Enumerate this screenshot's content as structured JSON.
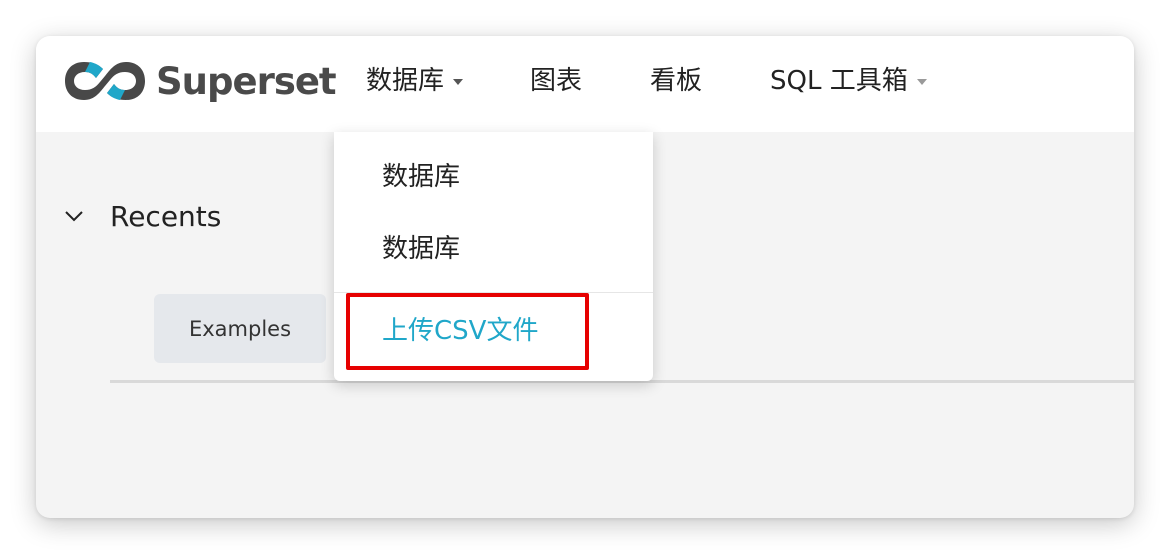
{
  "brand": {
    "name": "Superset",
    "logo_colors": {
      "dark": "#484848",
      "accent": "#20a7c9"
    }
  },
  "navbar": {
    "items": [
      {
        "label": "数据库",
        "has_caret": true
      },
      {
        "label": "图表",
        "has_caret": false
      },
      {
        "label": "看板",
        "has_caret": false
      },
      {
        "label": "SQL 工具箱",
        "has_caret": true
      }
    ]
  },
  "dropdown": {
    "items": [
      {
        "label": "数据库"
      },
      {
        "label": "数据库"
      },
      {
        "label": "上传CSV文件",
        "highlighted": true
      }
    ],
    "highlight_color": "#20a7c9",
    "annotation_color": "#e60000"
  },
  "recents": {
    "title": "Recents",
    "tabs": [
      {
        "label": "Examples"
      }
    ]
  }
}
